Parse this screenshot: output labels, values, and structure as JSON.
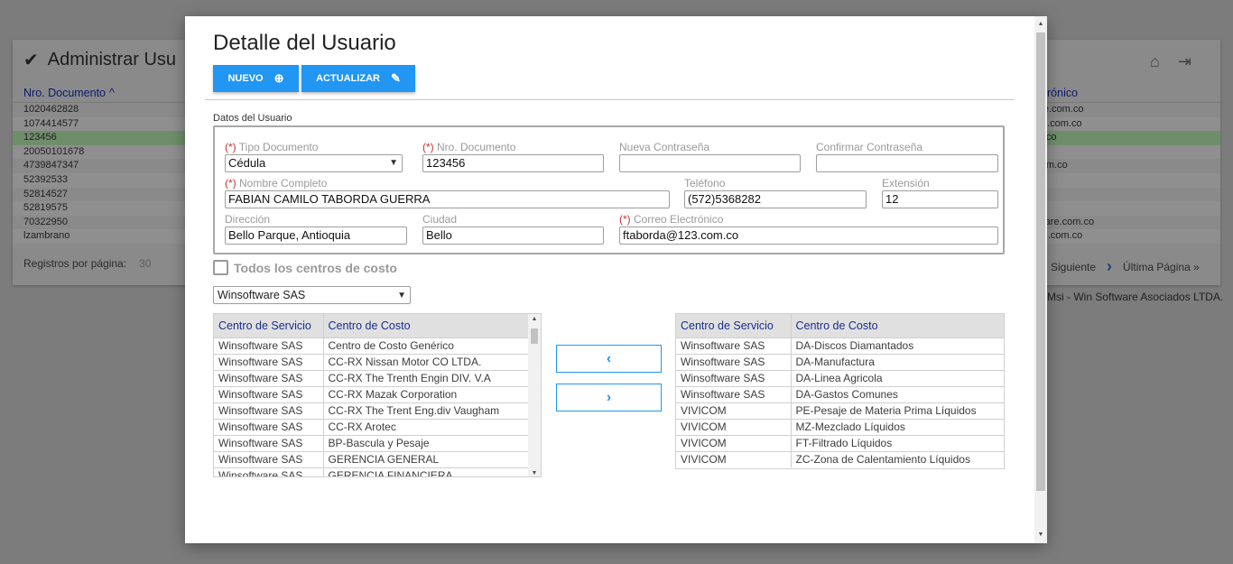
{
  "background": {
    "title": "Administrar Usu",
    "col_documento": "Nro. Documento",
    "col_correo": "rónico",
    "rows": [
      {
        "doc": "1020462828",
        "mail": "ftware.com.co"
      },
      {
        "doc": "1074414577",
        "mail": "fteare.com.co"
      },
      {
        "doc": "123456",
        "mail": ".com.co"
      },
      {
        "doc": "20050101678",
        "mail": ""
      },
      {
        "doc": "4739847347",
        "mail": "rio.com.co"
      },
      {
        "doc": "52392533",
        "mail": ""
      },
      {
        "doc": "52814527",
        "mail": ""
      },
      {
        "doc": "52819575",
        "mail": ""
      },
      {
        "doc": "70322950",
        "mail": "software.com.co"
      },
      {
        "doc": "lzambrano",
        "mail": "vicom.com.co"
      }
    ],
    "registros_label": "Registros por página:",
    "registros_value": "30",
    "siguiente": "Siguiente",
    "ultima": "Última Página »",
    "copyright": "Msi - Win Software Asociados LTDA."
  },
  "modal": {
    "title": "Detalle del Usuario",
    "btn_nuevo": "NUEVO",
    "btn_actualizar": "ACTUALIZAR",
    "section_label": "Datos del Usuario",
    "required_mark": "(*)",
    "fields": {
      "tipo_documento": {
        "label": " Tipo Documento",
        "value": "Cédula"
      },
      "nro_documento": {
        "label": " Nro. Documento",
        "value": "123456"
      },
      "nueva_contrasena": {
        "label": "Nueva Contraseña",
        "value": ""
      },
      "confirmar_contrasena": {
        "label": "Confirmar Contraseña",
        "value": ""
      },
      "nombre_completo": {
        "label": " Nombre Completo",
        "value": "FABIAN CAMILO TABORDA GUERRA"
      },
      "telefono": {
        "label": "Teléfono",
        "value": "(572)5368282"
      },
      "extension": {
        "label": "Extensión",
        "value": "12"
      },
      "direccion": {
        "label": "Dirección",
        "value": "Bello Parque, Antioquia"
      },
      "ciudad": {
        "label": "Ciudad",
        "value": "Bello"
      },
      "correo": {
        "label": " Correo Electrónico",
        "value": "ftaborda@123.com.co"
      }
    },
    "todos_centros": "Todos los centros de costo",
    "company": "Winsoftware SAS",
    "col_servicio": "Centro de Servicio",
    "col_costo": "Centro de Costo",
    "available": [
      {
        "servicio": "Winsoftware SAS",
        "costo": "Centro de Costo Genérico"
      },
      {
        "servicio": "Winsoftware SAS",
        "costo": "CC-RX Nissan Motor CO LTDA."
      },
      {
        "servicio": "Winsoftware SAS",
        "costo": "CC-RX The Trenth Engin DIV. V.A"
      },
      {
        "servicio": "Winsoftware SAS",
        "costo": "CC-RX Mazak Corporation"
      },
      {
        "servicio": "Winsoftware SAS",
        "costo": "CC-RX The Trent Eng.div Vaugham"
      },
      {
        "servicio": "Winsoftware SAS",
        "costo": "CC-RX Arotec"
      },
      {
        "servicio": "Winsoftware SAS",
        "costo": "BP-Bascula y Pesaje"
      },
      {
        "servicio": "Winsoftware SAS",
        "costo": "GERENCIA GENERAL"
      },
      {
        "servicio": "Winsoftware SAS",
        "costo": "GERENCIA FINANCIERA"
      }
    ],
    "assigned": [
      {
        "servicio": "Winsoftware SAS",
        "costo": "DA-Discos Diamantados"
      },
      {
        "servicio": "Winsoftware SAS",
        "costo": "DA-Manufactura"
      },
      {
        "servicio": "Winsoftware SAS",
        "costo": "DA-Linea Agricola"
      },
      {
        "servicio": "Winsoftware SAS",
        "costo": "DA-Gastos Comunes"
      },
      {
        "servicio": "VIVICOM",
        "costo": "PE-Pesaje de Materia Prima Líquidos"
      },
      {
        "servicio": "VIVICOM",
        "costo": "MZ-Mezclado Líquidos"
      },
      {
        "servicio": "VIVICOM",
        "costo": "FT-Filtrado Líquidos"
      },
      {
        "servicio": "VIVICOM",
        "costo": "ZC-Zona de Calentamiento Líquidos"
      }
    ],
    "move_left": "‹",
    "move_right": "›"
  }
}
